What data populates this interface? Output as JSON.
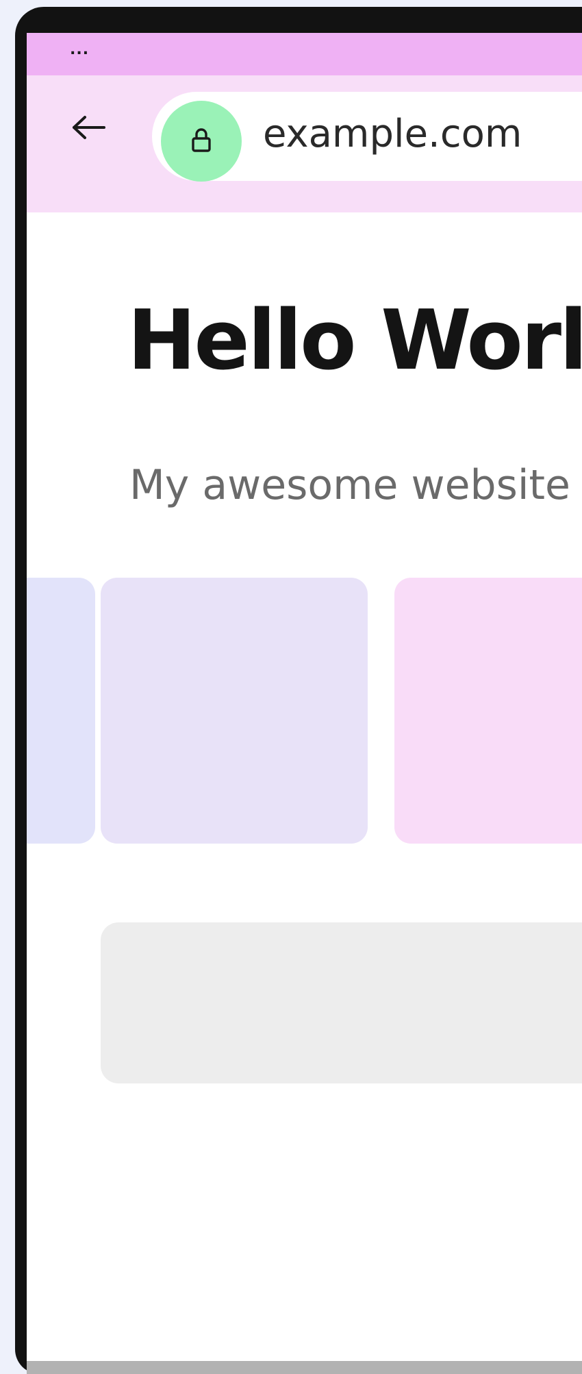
{
  "status_bar": {
    "menu_dots": "...",
    "color": "#efb1f4"
  },
  "browser": {
    "url": "example.com",
    "back_icon": "arrow-left-icon",
    "lock_icon": "lock-icon",
    "lock_badge_color": "#9af2b7",
    "toolbar_color": "#f8def8"
  },
  "page": {
    "title": "Hello World",
    "subtitle": "My awesome website"
  },
  "cards": [
    {
      "color": "#e2e3fa"
    },
    {
      "color": "#e8e2f8"
    },
    {
      "color": "#f9dcf8"
    }
  ],
  "banner": {
    "color": "#ededed"
  }
}
